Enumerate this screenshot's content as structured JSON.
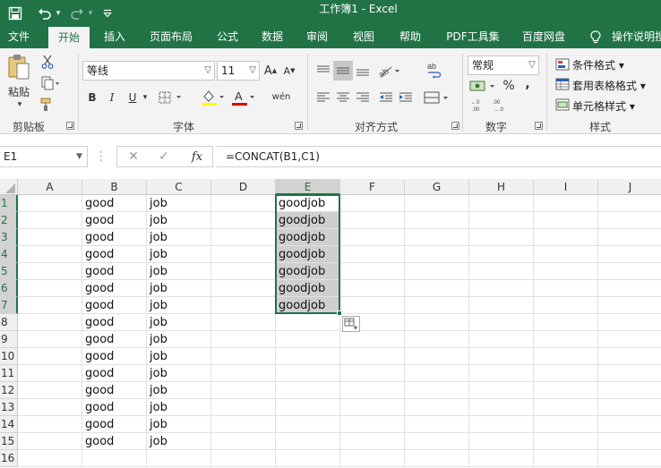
{
  "window": {
    "title": "工作簿1  -  Excel"
  },
  "quick_access": [
    {
      "name": "save-icon",
      "glyph": "🖫"
    },
    {
      "name": "undo-icon",
      "glyph": "↶"
    },
    {
      "name": "undo-dropdown-icon",
      "glyph": "▾"
    },
    {
      "name": "redo-icon",
      "glyph": "↷"
    },
    {
      "name": "redo-dropdown-icon",
      "glyph": "▾"
    },
    {
      "name": "customize-qat-icon",
      "glyph": "⊽"
    }
  ],
  "tabs": [
    "文件",
    "开始",
    "插入",
    "页面布局",
    "公式",
    "数据",
    "审阅",
    "视图",
    "帮助",
    "PDF工具集",
    "百度网盘"
  ],
  "active_tab": "开始",
  "tell_me": {
    "icon": "lightbulb-icon",
    "label": "操作说明搜"
  },
  "ribbon": {
    "clipboard": {
      "paste_label": "粘贴",
      "group_label": "剪贴板"
    },
    "font": {
      "font_name": "等线",
      "font_size": "11",
      "bold": "B",
      "italic": "I",
      "underline": "U",
      "phonetic": "wén",
      "grow": "A",
      "shrink": "A",
      "group_label": "字体",
      "highlight_color": "#ffff00",
      "font_color": "#e00000"
    },
    "alignment": {
      "group_label": "对齐方式"
    },
    "number": {
      "format": "常规",
      "percent": "%",
      "comma": ",",
      "group_label": "数字"
    },
    "styles": {
      "conditional": "条件格式",
      "table": "套用表格格式",
      "cell_styles": "单元格样式",
      "group_label": "样式"
    }
  },
  "formula_bar": {
    "name_box": "E1",
    "cancel": "✕",
    "enter": "✓",
    "fx": "fx",
    "formula": "=CONCAT(B1,C1)"
  },
  "columns": [
    "A",
    "B",
    "C",
    "D",
    "E",
    "F",
    "G",
    "H",
    "I",
    "J"
  ],
  "selected_column": "E",
  "rows": [
    {
      "n": "1",
      "B": "good",
      "C": "job",
      "E": "goodjob"
    },
    {
      "n": "2",
      "B": "good",
      "C": "job",
      "E": "goodjob"
    },
    {
      "n": "3",
      "B": "good",
      "C": "job",
      "E": "goodjob"
    },
    {
      "n": "4",
      "B": "good",
      "C": "job",
      "E": "goodjob"
    },
    {
      "n": "5",
      "B": "good",
      "C": "job",
      "E": "goodjob"
    },
    {
      "n": "6",
      "B": "good",
      "C": "job",
      "E": "goodjob"
    },
    {
      "n": "7",
      "B": "good",
      "C": "job",
      "E": "goodjob"
    },
    {
      "n": "8",
      "B": "good",
      "C": "job",
      "E": ""
    },
    {
      "n": "9",
      "B": "good",
      "C": "job",
      "E": ""
    },
    {
      "n": "10",
      "B": "good",
      "C": "job",
      "E": ""
    },
    {
      "n": "11",
      "B": "good",
      "C": "job",
      "E": ""
    },
    {
      "n": "12",
      "B": "good",
      "C": "job",
      "E": ""
    },
    {
      "n": "13",
      "B": "good",
      "C": "job",
      "E": ""
    },
    {
      "n": "14",
      "B": "good",
      "C": "job",
      "E": ""
    },
    {
      "n": "15",
      "B": "good",
      "C": "job",
      "E": ""
    },
    {
      "n": "16",
      "B": "",
      "C": "",
      "E": ""
    }
  ],
  "selected_rows": [
    "1",
    "2",
    "3",
    "4",
    "5",
    "6",
    "7"
  ],
  "colors": {
    "accent": "#217346",
    "selection_fill": "#cfcfcf"
  }
}
